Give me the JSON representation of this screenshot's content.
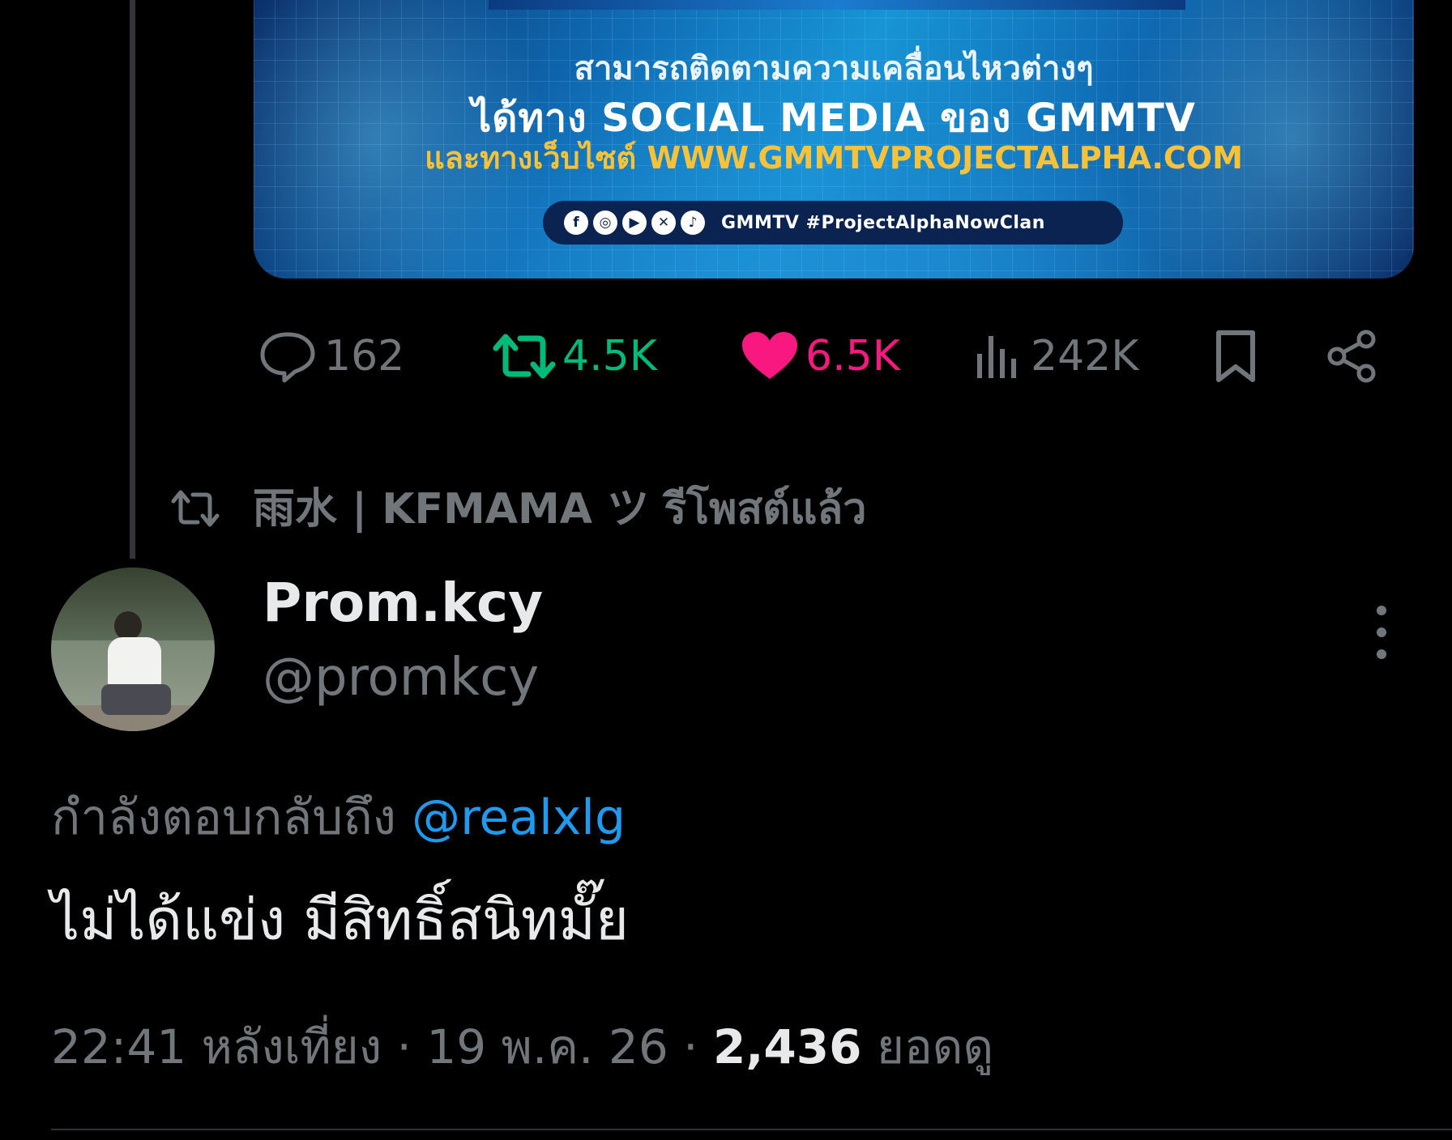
{
  "promo": {
    "line1": "สามารถติดตามความเคลื่อนไหวต่างๆ",
    "line2": "ได้ทาง SOCIAL MEDIA ของ GMMTV",
    "line3": "และทางเว็บไซต์ WWW.GMMTVPROJECTALPHA.COM",
    "socials": [
      "facebook-icon",
      "instagram-icon",
      "youtube-icon",
      "x-icon",
      "tiktok-icon"
    ],
    "hashtag": "GMMTV #ProjectAlphaNowClan"
  },
  "actions": {
    "replies": "162",
    "retweets": "4.5K",
    "likes": "6.5K",
    "views": "242K"
  },
  "repost": {
    "label": "雨水 | KFMAMA ツ รีโพสต์แล้ว"
  },
  "tweet": {
    "display_name": "Prom.kcy",
    "handle": "@promkcy",
    "replying_prefix": "กำลังตอบกลับถึง",
    "replying_to": "@realxlg",
    "text": "ไม่ได้แข่ง มีสิทธิ์สนิทมั๊ย",
    "time": "22:41 หลังเที่ยง · 19 พ.ค. 26 ·",
    "views_count": "2,436",
    "views_label": "ยอดดู"
  },
  "colors": {
    "background": "#000000",
    "retweet": "#00ba7c",
    "like": "#f91880",
    "mention": "#1d9bf0",
    "muted": "#71767b"
  }
}
